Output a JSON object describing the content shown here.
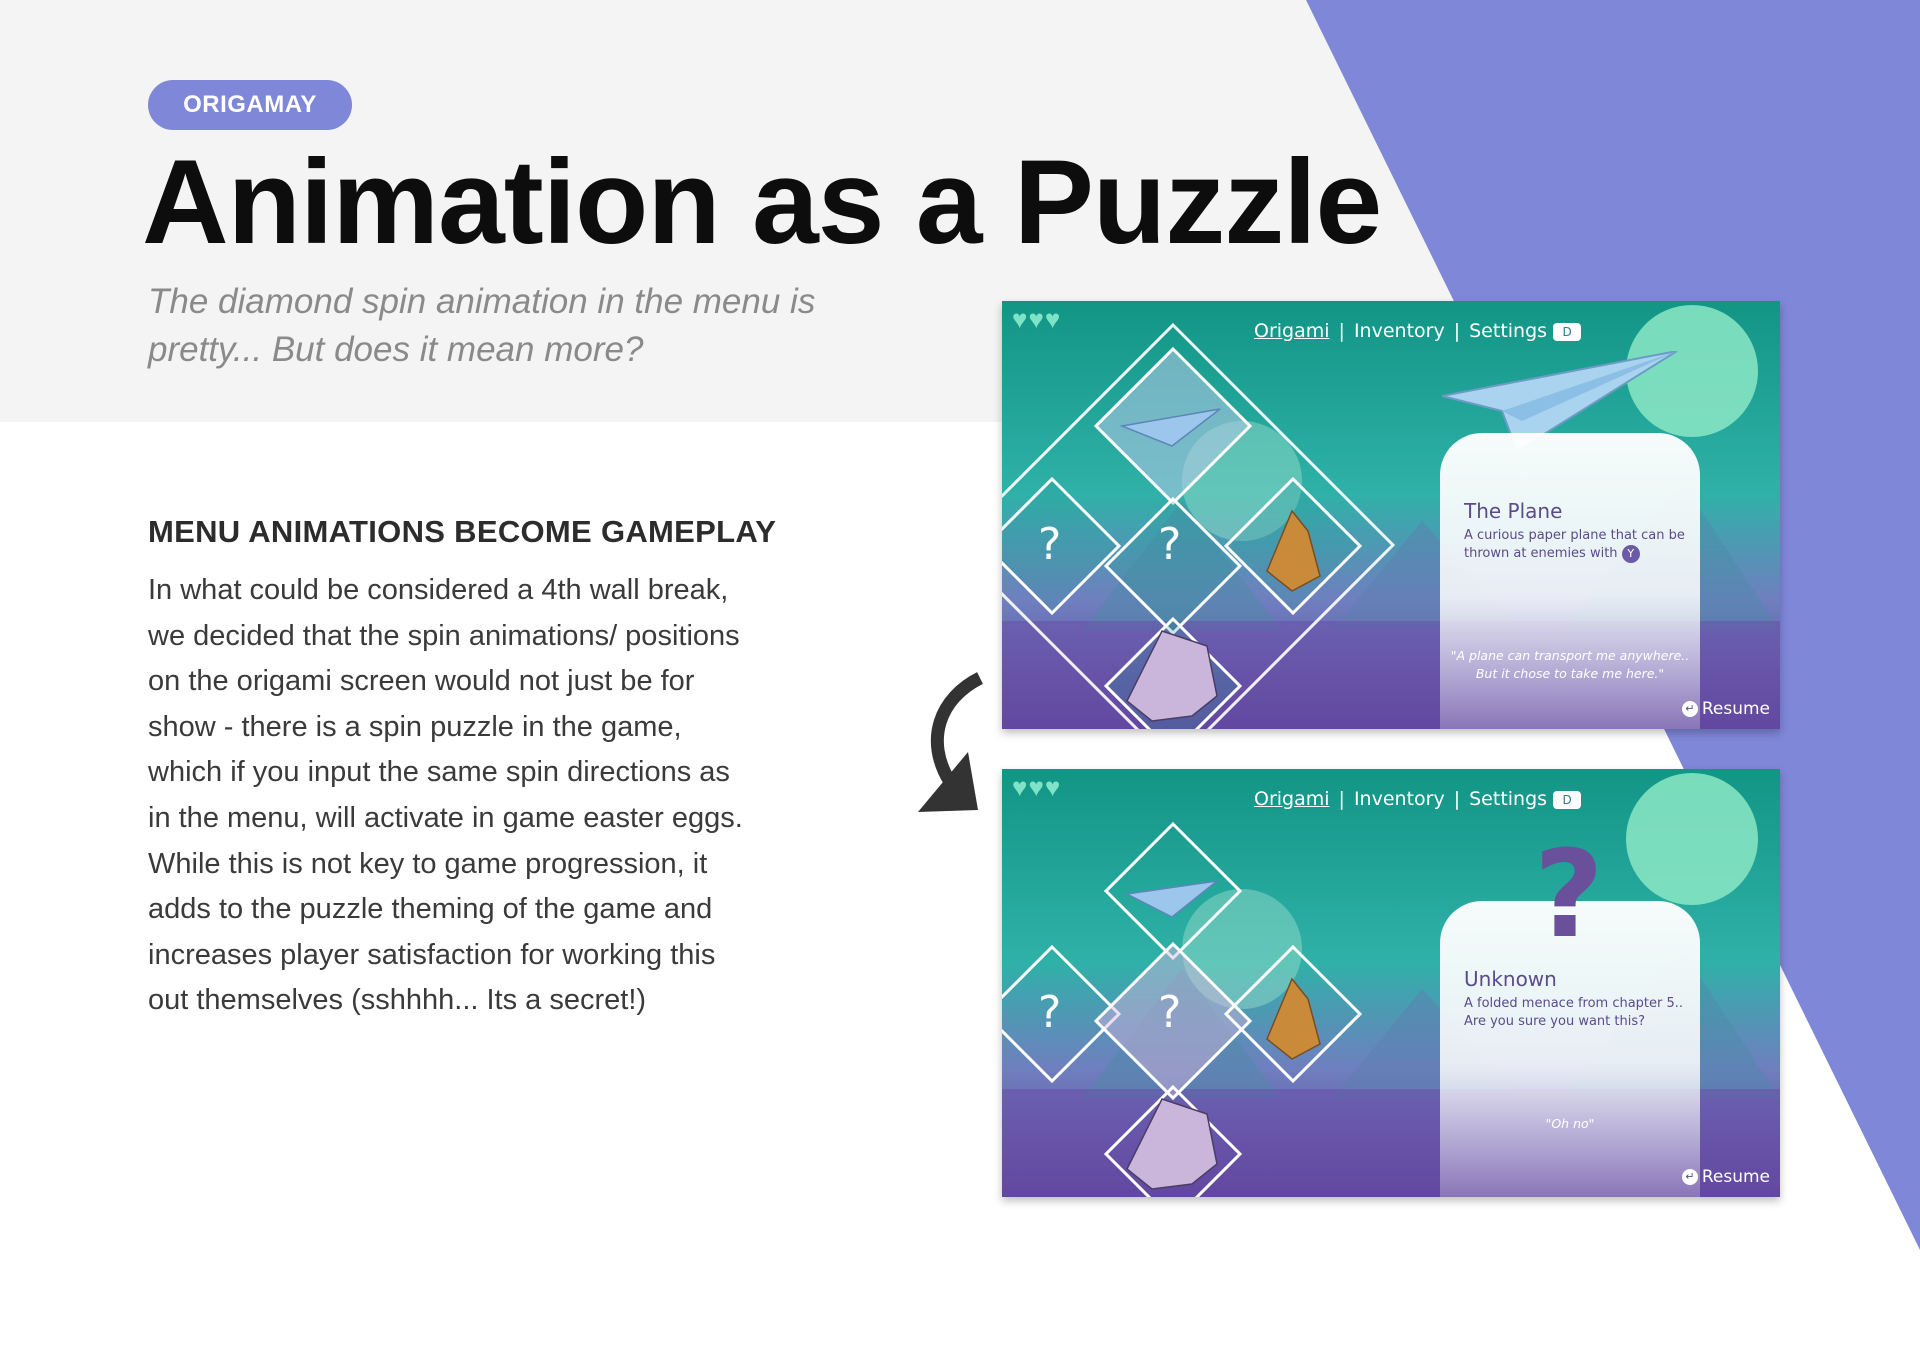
{
  "tag": "ORIGAMAY",
  "title": "Animation as a Puzzle",
  "subtitle": "The diamond spin animation in the menu is pretty... But does it mean more?",
  "section": {
    "heading": "MENU ANIMATIONS BECOME GAMEPLAY",
    "body": "In what could be considered a 4th wall break, we decided that the spin animations/ positions on the origami screen would not just be for show - there is a spin puzzle in the game, which if you input the same spin directions as in the menu, will activate in game easter eggs. While this is not key to game progression, it adds to the puzzle theming of the game and increases player satisfaction for working this out themselves (sshhhh... Its a secret!)"
  },
  "colors": {
    "accent": "#7f87d9",
    "title": "#0d0d0d",
    "subtitle": "#8a8a8a",
    "body": "#3a3a3a"
  },
  "arrow_icon": "curved-arrow-down-left",
  "screens": [
    {
      "menu": {
        "origami": "Origami",
        "inventory": "Inventory",
        "settings": "Settings",
        "settings_key": "D"
      },
      "card": {
        "title": "The Plane",
        "desc": "A curious paper plane that can be thrown at enemies with",
        "button": "Y",
        "quote": "\"A plane can transport me anywhere.. But it chose to take me here.\""
      },
      "resume": "Resume",
      "locked_marks": [
        "?",
        "?"
      ]
    },
    {
      "menu": {
        "origami": "Origami",
        "inventory": "Inventory",
        "settings": "Settings",
        "settings_key": "D"
      },
      "card": {
        "title": "Unknown",
        "desc": "A folded menace from chapter 5.. Are you sure you want this?",
        "quote": "\"Oh no\""
      },
      "big_mark": "?",
      "resume": "Resume",
      "locked_marks": [
        "?",
        "?"
      ]
    }
  ]
}
